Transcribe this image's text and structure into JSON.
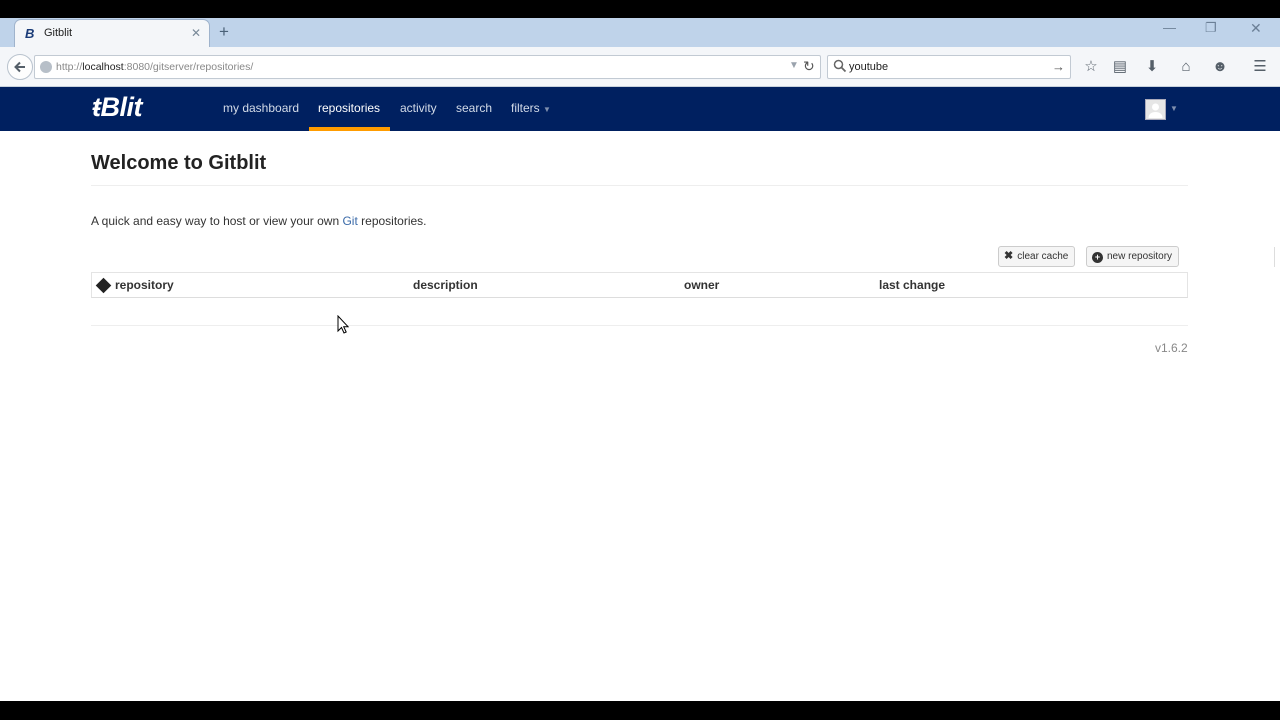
{
  "browser": {
    "tab_title": "Gitblit",
    "tab_favicon": "B",
    "new_tab_label": "+",
    "close_tab_label": "✕",
    "url_prefix": "http://",
    "url_host": "localhost",
    "url_rest": ":8080/gitserver/repositories/",
    "search_value": "youtube",
    "icons": {
      "back": "back-arrow-icon",
      "reload": "reload-icon",
      "bookmark": "star-icon",
      "library": "clipboard-icon",
      "downloads": "download-icon",
      "home": "home-icon",
      "chat": "chat-icon",
      "menu": "hamburger-menu-icon"
    }
  },
  "gitblit": {
    "brand": "Blit",
    "brand_prefix": "ŧ",
    "nav": [
      {
        "label": "my dashboard"
      },
      {
        "label": "repositories",
        "active": true
      },
      {
        "label": "activity"
      },
      {
        "label": "search"
      },
      {
        "label": "filters"
      }
    ],
    "colors": {
      "header_bg": "#002060",
      "active_underline": "#ff9c00",
      "link": "#3a6aa8"
    }
  },
  "page": {
    "title": "Welcome to Gitblit",
    "intro_before": "A quick and easy way to host or view your own ",
    "intro_link": "Git",
    "intro_after": " repositories.",
    "clear_cache_label": "clear cache",
    "new_repository_label": "new repository",
    "table_headers": {
      "repository": "repository",
      "description": "description",
      "owner": "owner",
      "last_change": "last change"
    },
    "rows": [],
    "version": "v1.6.2"
  }
}
